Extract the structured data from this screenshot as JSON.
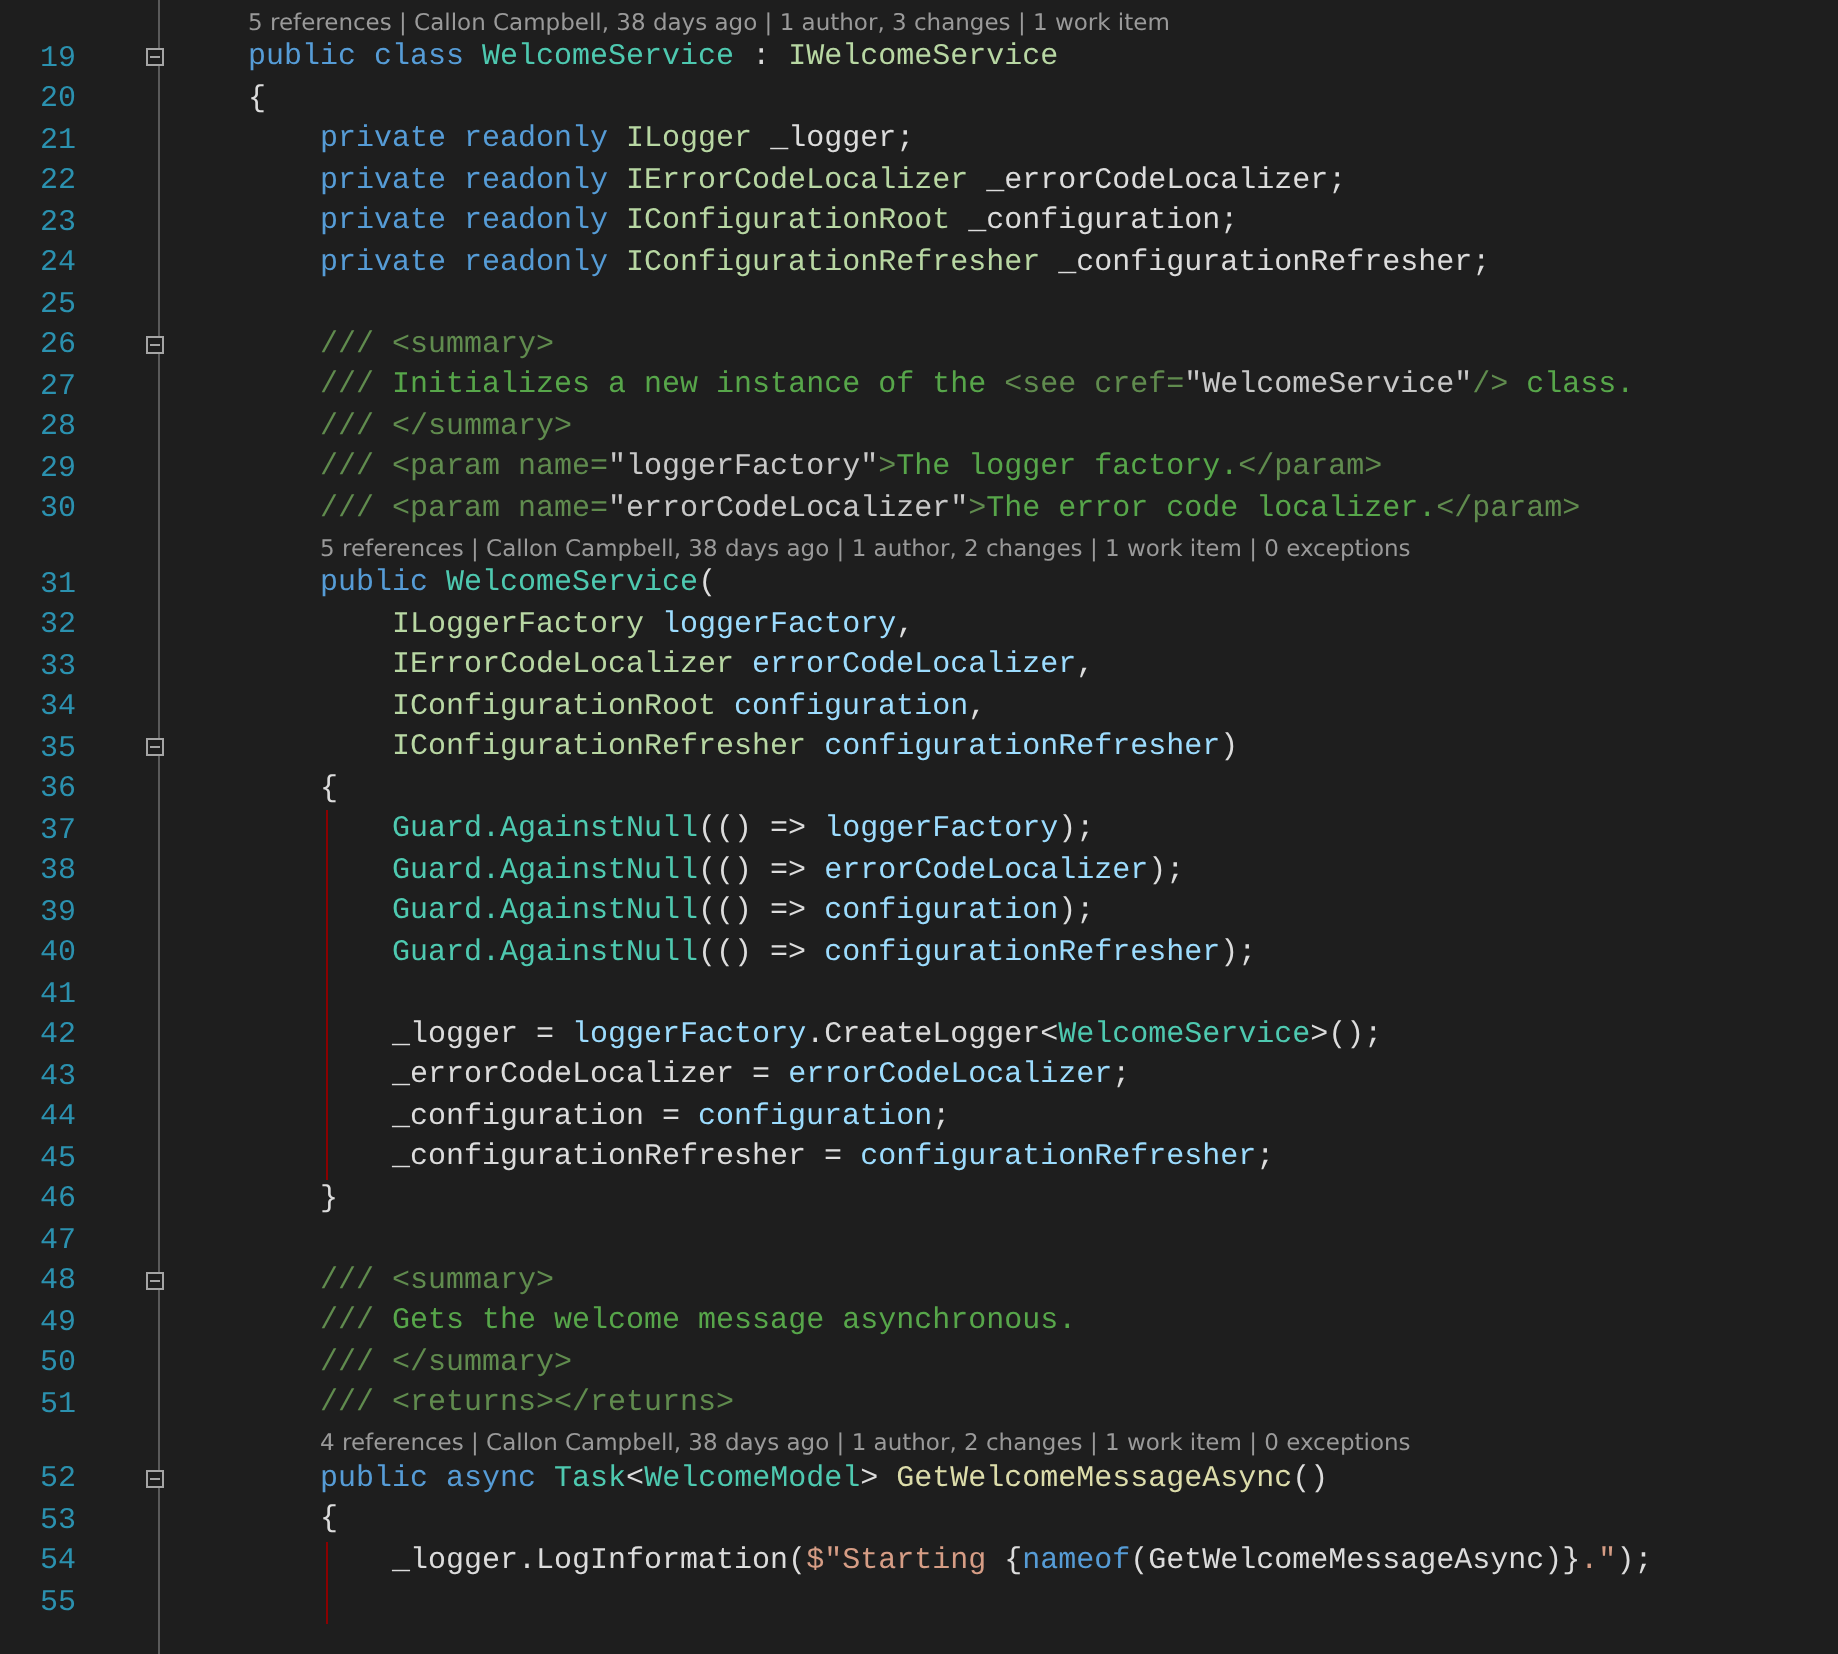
{
  "editor": {
    "lines": [
      {
        "number": "19",
        "codelens": "5 references | Callon Campbell, 38 days ago | 1 author, 3 changes | 1 work item",
        "expanded": true,
        "tokens": [
          {
            "text": "    public class ",
            "kind": "keyword"
          },
          {
            "text": "WelcomeService",
            "kind": "class"
          },
          {
            "text": " : ",
            "kind": "plain"
          },
          {
            "text": "IWelcomeService",
            "kind": "interface"
          }
        ]
      },
      {
        "number": "20",
        "tokens": [
          {
            "text": "    {",
            "kind": "plain"
          }
        ]
      },
      {
        "number": "21",
        "tokens": [
          {
            "text": "        private readonly ",
            "kind": "keyword"
          },
          {
            "text": "ILogger",
            "kind": "interface"
          },
          {
            "text": " _logger;",
            "kind": "plain"
          }
        ]
      },
      {
        "number": "22",
        "tokens": [
          {
            "text": "        private readonly ",
            "kind": "keyword"
          },
          {
            "text": "IErrorCodeLocalizer",
            "kind": "interface"
          },
          {
            "text": " _errorCodeLocalizer;",
            "kind": "plain"
          }
        ]
      },
      {
        "number": "23",
        "tokens": [
          {
            "text": "        private readonly ",
            "kind": "keyword"
          },
          {
            "text": "IConfigurationRoot",
            "kind": "interface"
          },
          {
            "text": " _configuration;",
            "kind": "plain"
          }
        ]
      },
      {
        "number": "24",
        "tokens": [
          {
            "text": "        private readonly ",
            "kind": "keyword"
          },
          {
            "text": "IConfigurationRefresher",
            "kind": "interface"
          },
          {
            "text": " _configurationRefresher;",
            "kind": "plain"
          }
        ]
      },
      {
        "number": "25"
      },
      {
        "number": "26",
        "expanded": true,
        "tokens": [
          {
            "text": "        /// <summary>",
            "kind": "doc-tag"
          }
        ]
      },
      {
        "number": "27",
        "tokens": [
          {
            "text": "        /// ",
            "kind": "doc-tag"
          },
          {
            "text": "Initializes a new instance of the ",
            "kind": "doc-text"
          },
          {
            "text": "<see cref=",
            "kind": "doc-tag"
          },
          {
            "text": "\"WelcomeService\"",
            "kind": "doc-value"
          },
          {
            "text": "/>",
            "kind": "doc-tag"
          },
          {
            "text": " class.",
            "kind": "doc-text"
          }
        ]
      },
      {
        "number": "28",
        "tokens": [
          {
            "text": "        /// </summary>",
            "kind": "doc-tag"
          }
        ]
      },
      {
        "number": "29",
        "tokens": [
          {
            "text": "        /// <param name=",
            "kind": "doc-tag"
          },
          {
            "text": "\"loggerFactory\"",
            "kind": "doc-value"
          },
          {
            "text": ">",
            "kind": "doc-tag"
          },
          {
            "text": "The logger factory.",
            "kind": "doc-text"
          },
          {
            "text": "</param>",
            "kind": "doc-tag"
          }
        ]
      },
      {
        "number": "30",
        "tokens": [
          {
            "text": "        /// <param name=",
            "kind": "doc-tag"
          },
          {
            "text": "\"errorCodeLocalizer\"",
            "kind": "doc-value"
          },
          {
            "text": ">",
            "kind": "doc-tag"
          },
          {
            "text": "The error code localizer.",
            "kind": "doc-text"
          },
          {
            "text": "</param>",
            "kind": "doc-tag"
          }
        ]
      },
      {
        "number": "31",
        "codelens": "5 references | Callon Campbell, 38 days ago | 1 author, 2 changes | 1 work item | 0 exceptions",
        "tokens": [
          {
            "text": "        public ",
            "kind": "keyword"
          },
          {
            "text": "WelcomeService",
            "kind": "class"
          },
          {
            "text": "(",
            "kind": "plain"
          }
        ]
      },
      {
        "number": "32",
        "tokens": [
          {
            "text": "            ILoggerFactory",
            "kind": "interface"
          },
          {
            "text": " loggerFactory",
            "kind": "parameter"
          },
          {
            "text": ",",
            "kind": "plain"
          }
        ]
      },
      {
        "number": "33",
        "tokens": [
          {
            "text": "            IErrorCodeLocalizer",
            "kind": "interface"
          },
          {
            "text": " errorCodeLocalizer",
            "kind": "parameter"
          },
          {
            "text": ",",
            "kind": "plain"
          }
        ]
      },
      {
        "number": "34",
        "tokens": [
          {
            "text": "            IConfigurationRoot",
            "kind": "interface"
          },
          {
            "text": " configuration",
            "kind": "parameter"
          },
          {
            "text": ",",
            "kind": "plain"
          }
        ]
      },
      {
        "number": "35",
        "expanded": true,
        "tokens": [
          {
            "text": "            IConfigurationRefresher",
            "kind": "interface"
          },
          {
            "text": " configurationRefresher",
            "kind": "parameter"
          },
          {
            "text": ")",
            "kind": "plain"
          }
        ]
      },
      {
        "number": "36",
        "tokens": [
          {
            "text": "        {",
            "kind": "plain"
          }
        ]
      },
      {
        "number": "37",
        "guide": true,
        "tokens": [
          {
            "text": "            Guard.AgainstNull",
            "kind": "class"
          },
          {
            "text": "(() => ",
            "kind": "plain"
          },
          {
            "text": "loggerFactory",
            "kind": "parameter"
          },
          {
            "text": ");",
            "kind": "plain"
          }
        ]
      },
      {
        "number": "38",
        "guide": true,
        "tokens": [
          {
            "text": "            Guard.AgainstNull",
            "kind": "class"
          },
          {
            "text": "(() => ",
            "kind": "plain"
          },
          {
            "text": "errorCodeLocalizer",
            "kind": "parameter"
          },
          {
            "text": ");",
            "kind": "plain"
          }
        ]
      },
      {
        "number": "39",
        "guide": true,
        "tokens": [
          {
            "text": "            Guard.AgainstNull",
            "kind": "class"
          },
          {
            "text": "(() => ",
            "kind": "plain"
          },
          {
            "text": "configuration",
            "kind": "parameter"
          },
          {
            "text": ");",
            "kind": "plain"
          }
        ]
      },
      {
        "number": "40",
        "guide": true,
        "tokens": [
          {
            "text": "            Guard.AgainstNull",
            "kind": "class"
          },
          {
            "text": "(() => ",
            "kind": "plain"
          },
          {
            "text": "configurationRefresher",
            "kind": "parameter"
          },
          {
            "text": ");",
            "kind": "plain"
          }
        ]
      },
      {
        "number": "41",
        "guide": true
      },
      {
        "number": "42",
        "guide": true,
        "tokens": [
          {
            "text": "            _logger = ",
            "kind": "plain"
          },
          {
            "text": "loggerFactory",
            "kind": "parameter"
          },
          {
            "text": ".CreateLogger<",
            "kind": "plain"
          },
          {
            "text": "WelcomeService",
            "kind": "class"
          },
          {
            "text": ">();",
            "kind": "plain"
          }
        ]
      },
      {
        "number": "43",
        "guide": true,
        "tokens": [
          {
            "text": "            _errorCodeLocalizer = ",
            "kind": "plain"
          },
          {
            "text": "errorCodeLocalizer",
            "kind": "parameter"
          },
          {
            "text": ";",
            "kind": "plain"
          }
        ]
      },
      {
        "number": "44",
        "guide": true,
        "tokens": [
          {
            "text": "            _configuration = ",
            "kind": "plain"
          },
          {
            "text": "configuration",
            "kind": "parameter"
          },
          {
            "text": ";",
            "kind": "plain"
          }
        ]
      },
      {
        "number": "45",
        "guide": true,
        "tokens": [
          {
            "text": "            _configurationRefresher = ",
            "kind": "plain"
          },
          {
            "text": "configurationRefresher",
            "kind": "parameter"
          },
          {
            "text": ";",
            "kind": "plain"
          }
        ]
      },
      {
        "number": "46",
        "tokens": [
          {
            "text": "        }",
            "kind": "plain"
          }
        ]
      },
      {
        "number": "47"
      },
      {
        "number": "48",
        "expanded": true,
        "tokens": [
          {
            "text": "        /// <summary>",
            "kind": "doc-tag"
          }
        ]
      },
      {
        "number": "49",
        "tokens": [
          {
            "text": "        /// ",
            "kind": "doc-tag"
          },
          {
            "text": "Gets the welcome message asynchronous.",
            "kind": "doc-text"
          }
        ]
      },
      {
        "number": "50",
        "tokens": [
          {
            "text": "        /// </summary>",
            "kind": "doc-tag"
          }
        ]
      },
      {
        "number": "51",
        "tokens": [
          {
            "text": "        /// <returns></returns>",
            "kind": "doc-tag"
          }
        ]
      },
      {
        "number": "52",
        "codelens": "4 references | Callon Campbell, 38 days ago | 1 author, 2 changes | 1 work item | 0 exceptions",
        "expanded": true,
        "tokens": [
          {
            "text": "        public async ",
            "kind": "keyword"
          },
          {
            "text": "Task",
            "kind": "class"
          },
          {
            "text": "<",
            "kind": "plain"
          },
          {
            "text": "WelcomeModel",
            "kind": "class"
          },
          {
            "text": "> ",
            "kind": "plain"
          },
          {
            "text": "GetWelcomeMessageAsync",
            "kind": "method"
          },
          {
            "text": "()",
            "kind": "plain"
          }
        ]
      },
      {
        "number": "53",
        "tokens": [
          {
            "text": "        {",
            "kind": "plain"
          }
        ]
      },
      {
        "number": "54",
        "guide": true,
        "tokens": [
          {
            "text": "            _logger.LogInformation(",
            "kind": "plain"
          },
          {
            "text": "$\"Starting ",
            "kind": "string"
          },
          {
            "text": "{",
            "kind": "plain"
          },
          {
            "text": "nameof",
            "kind": "keyword"
          },
          {
            "text": "(GetWelcomeMessageAsync)}",
            "kind": "plain"
          },
          {
            "text": ".\"",
            "kind": "string"
          },
          {
            "text": ");",
            "kind": "plain"
          }
        ]
      },
      {
        "number": "55",
        "guide": true
      }
    ]
  }
}
